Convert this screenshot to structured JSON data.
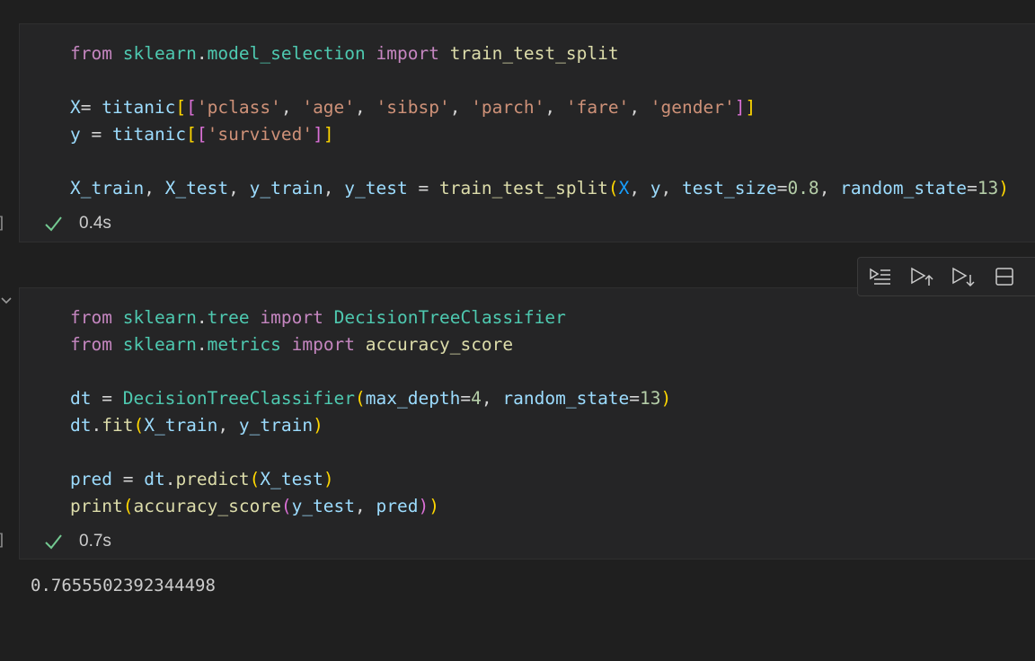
{
  "cells": [
    {
      "lines": [
        [
          {
            "t": "from",
            "c": "kw"
          },
          {
            "t": " "
          },
          {
            "t": "sklearn",
            "c": "mod"
          },
          {
            "t": "."
          },
          {
            "t": "model_selection",
            "c": "mod"
          },
          {
            "t": " "
          },
          {
            "t": "import",
            "c": "kw"
          },
          {
            "t": " "
          },
          {
            "t": "train_test_split",
            "c": "fn"
          }
        ],
        [],
        [
          {
            "t": "X",
            "c": "var"
          },
          {
            "t": "= "
          },
          {
            "t": "titanic",
            "c": "var"
          },
          {
            "t": "[",
            "c": "p1"
          },
          {
            "t": "[",
            "c": "p2"
          },
          {
            "t": "'pclass'",
            "c": "str"
          },
          {
            "t": ", "
          },
          {
            "t": "'age'",
            "c": "str"
          },
          {
            "t": ", "
          },
          {
            "t": "'sibsp'",
            "c": "str"
          },
          {
            "t": ", "
          },
          {
            "t": "'parch'",
            "c": "str"
          },
          {
            "t": ", "
          },
          {
            "t": "'fare'",
            "c": "str"
          },
          {
            "t": ", "
          },
          {
            "t": "'gender'",
            "c": "str"
          },
          {
            "t": "]",
            "c": "p2"
          },
          {
            "t": "]",
            "c": "p1"
          }
        ],
        [
          {
            "t": "y",
            "c": "var"
          },
          {
            "t": " = "
          },
          {
            "t": "titanic",
            "c": "var"
          },
          {
            "t": "[",
            "c": "p1"
          },
          {
            "t": "[",
            "c": "p2"
          },
          {
            "t": "'survived'",
            "c": "str"
          },
          {
            "t": "]",
            "c": "p2"
          },
          {
            "t": "]",
            "c": "p1"
          }
        ],
        [],
        [
          {
            "t": "X_train",
            "c": "var"
          },
          {
            "t": ", "
          },
          {
            "t": "X_test",
            "c": "var"
          },
          {
            "t": ", "
          },
          {
            "t": "y_train",
            "c": "var"
          },
          {
            "t": ", "
          },
          {
            "t": "y_test",
            "c": "var"
          },
          {
            "t": " = "
          },
          {
            "t": "train_test_split",
            "c": "fn"
          },
          {
            "t": "(",
            "c": "p1"
          },
          {
            "t": "X",
            "c": "p3"
          },
          {
            "t": ", "
          },
          {
            "t": "y",
            "c": "var"
          },
          {
            "t": ", "
          },
          {
            "t": "test_size",
            "c": "var"
          },
          {
            "t": "="
          },
          {
            "t": "0.8",
            "c": "num"
          },
          {
            "t": ", "
          },
          {
            "t": "random_state",
            "c": "var"
          },
          {
            "t": "="
          },
          {
            "t": "13",
            "c": "num"
          },
          {
            "t": ")",
            "c": "p1"
          }
        ]
      ],
      "exec_time": "0.4s",
      "bracket": "]"
    },
    {
      "lines": [
        [
          {
            "t": "from",
            "c": "kw"
          },
          {
            "t": " "
          },
          {
            "t": "sklearn",
            "c": "mod"
          },
          {
            "t": "."
          },
          {
            "t": "tree",
            "c": "mod"
          },
          {
            "t": " "
          },
          {
            "t": "import",
            "c": "kw"
          },
          {
            "t": " "
          },
          {
            "t": "DecisionTreeClassifier",
            "c": "cls"
          }
        ],
        [
          {
            "t": "from",
            "c": "kw"
          },
          {
            "t": " "
          },
          {
            "t": "sklearn",
            "c": "mod"
          },
          {
            "t": "."
          },
          {
            "t": "metrics",
            "c": "mod"
          },
          {
            "t": " "
          },
          {
            "t": "import",
            "c": "kw"
          },
          {
            "t": " "
          },
          {
            "t": "accuracy_score",
            "c": "fn"
          }
        ],
        [],
        [
          {
            "t": "dt",
            "c": "var"
          },
          {
            "t": " = "
          },
          {
            "t": "DecisionTreeClassifier",
            "c": "cls"
          },
          {
            "t": "(",
            "c": "p1"
          },
          {
            "t": "max_depth",
            "c": "var"
          },
          {
            "t": "="
          },
          {
            "t": "4",
            "c": "num"
          },
          {
            "t": ", "
          },
          {
            "t": "random_state",
            "c": "var"
          },
          {
            "t": "="
          },
          {
            "t": "13",
            "c": "num"
          },
          {
            "t": ")",
            "c": "p1"
          }
        ],
        [
          {
            "t": "dt",
            "c": "var"
          },
          {
            "t": "."
          },
          {
            "t": "fit",
            "c": "fn"
          },
          {
            "t": "(",
            "c": "p1"
          },
          {
            "t": "X_train",
            "c": "var"
          },
          {
            "t": ", "
          },
          {
            "t": "y_train",
            "c": "var"
          },
          {
            "t": ")",
            "c": "p1"
          }
        ],
        [],
        [
          {
            "t": "pred",
            "c": "var"
          },
          {
            "t": " = "
          },
          {
            "t": "dt",
            "c": "var"
          },
          {
            "t": "."
          },
          {
            "t": "predict",
            "c": "fn"
          },
          {
            "t": "(",
            "c": "p1"
          },
          {
            "t": "X_test",
            "c": "var"
          },
          {
            "t": ")",
            "c": "p1"
          }
        ],
        [
          {
            "t": "print",
            "c": "fn"
          },
          {
            "t": "(",
            "c": "p1"
          },
          {
            "t": "accuracy_score",
            "c": "fn"
          },
          {
            "t": "(",
            "c": "p2"
          },
          {
            "t": "y_test",
            "c": "var"
          },
          {
            "t": ", "
          },
          {
            "t": "pred",
            "c": "var"
          },
          {
            "t": ")",
            "c": "p2"
          },
          {
            "t": ")",
            "c": "p1"
          }
        ]
      ],
      "exec_time": "0.7s",
      "bracket": "]"
    }
  ],
  "output": "0.7655502392344498",
  "colors": {
    "success_check": "#73c991",
    "background": "#1f1f1f",
    "cell_background": "#252526"
  },
  "toolbar": {
    "icons": [
      "run-by-line-icon",
      "execute-above-icon",
      "execute-below-icon",
      "split-cell-icon"
    ]
  }
}
